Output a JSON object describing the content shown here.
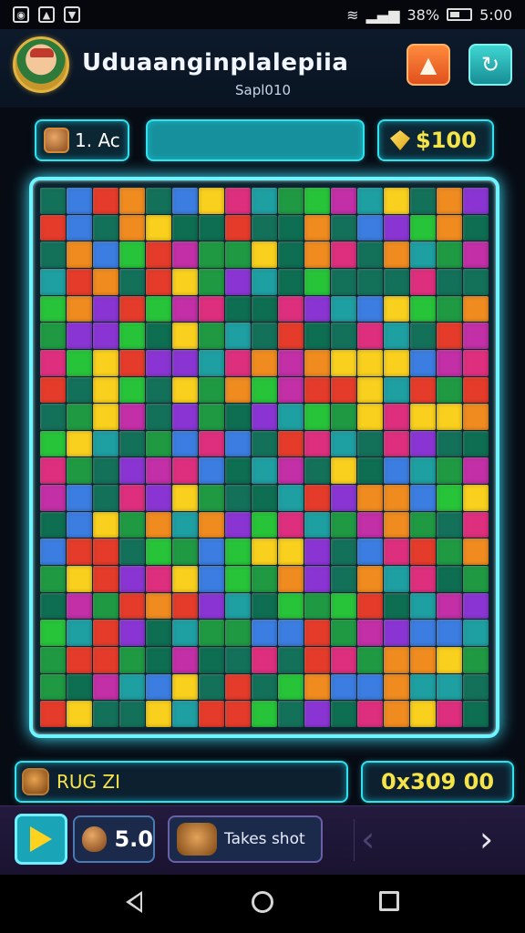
{
  "status_bar": {
    "left_icons": [
      "notification-icon",
      "gallery-icon",
      "download-icon"
    ],
    "battery_text": "38%",
    "time": "5:00"
  },
  "header": {
    "title": "Uduaanginplalepiia",
    "subtitle": "Sapl010",
    "avatar": "player-avatar",
    "buttons": [
      "alert-icon",
      "refresh-icon"
    ]
  },
  "info": {
    "level": "1. Ac",
    "money": "$100"
  },
  "bottom": {
    "bag_label": "RUG ZI",
    "score": "0x309 00"
  },
  "toolbar": {
    "count": "5.0",
    "take_label": "Takes shot"
  },
  "colors": {
    "accent": "#33e0ee",
    "gold": "#f5e34a",
    "pieces": [
      "#f9d01d",
      "#e53b2a",
      "#f08b1f",
      "#27c43a",
      "#1f9a43",
      "#13715a",
      "#3b7de0",
      "#1e9fa2",
      "#8a35d3",
      "#c22fa6",
      "#dd2f7e",
      "#0e6e52"
    ]
  },
  "navbar": [
    "back-icon",
    "home-icon",
    "recent-apps-icon"
  ]
}
